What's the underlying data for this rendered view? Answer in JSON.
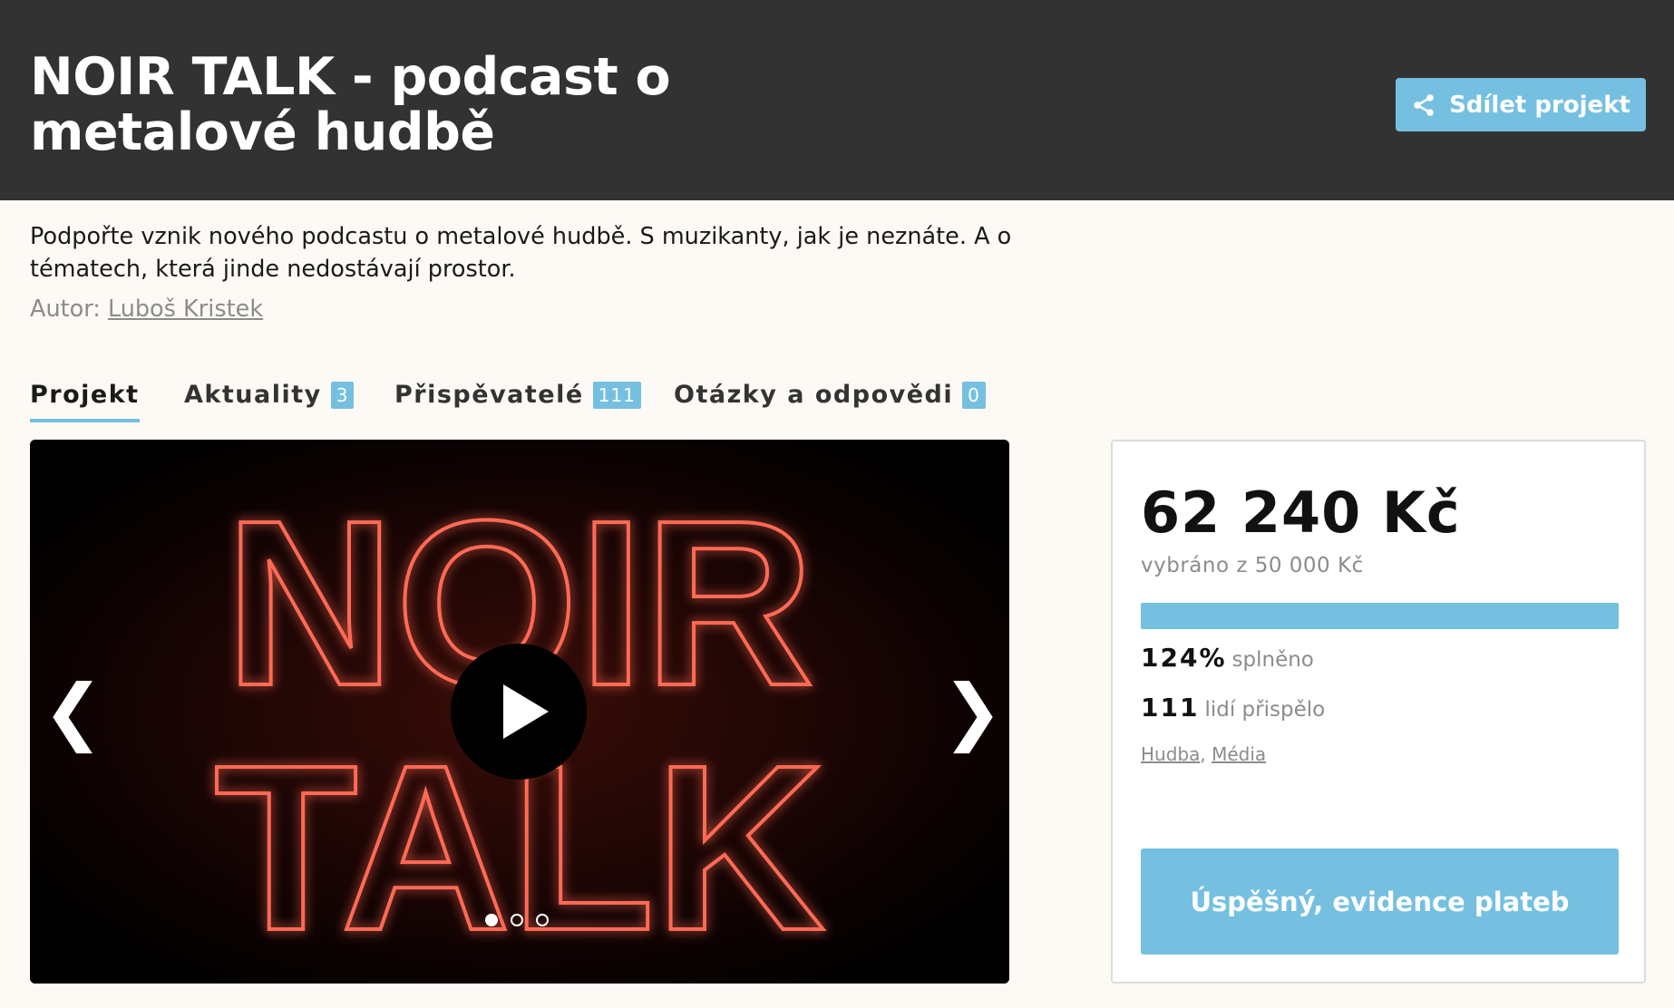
{
  "header": {
    "title": "NOIR TALK - podcast o metalové hudbě",
    "share_label": "Sdílet projekt",
    "share_icon": "share-icon",
    "background_color": "#323232",
    "accent_color": "#75c0e0"
  },
  "intro": {
    "description": "Podpořte vznik nového podcastu o metalové hudbě. S muzikanty, jak je neznáte. A o tématech, která jinde nedostávají prostor.",
    "author_prefix": "Autor:",
    "author_name": "Luboš Kristek"
  },
  "tabs": [
    {
      "label": "Projekt",
      "count": null,
      "active": true
    },
    {
      "label": "Aktuality",
      "count": "3",
      "active": false
    },
    {
      "label": "Přispěvatelé",
      "count": "111",
      "active": false
    },
    {
      "label": "Otázky a odpovědi",
      "count": "0",
      "active": false
    }
  ],
  "media": {
    "logo_text_line1": "NOIR",
    "logo_text_line2": "TALK",
    "prev_arrow": "❮",
    "next_arrow": "❯",
    "play_icon": "play-icon",
    "slides_count": 3,
    "active_slide": 1
  },
  "panel": {
    "amount": "62 240 Kč",
    "collected_text": "vybráno z 50 000 Kč",
    "progress_fraction": 1.0,
    "percent": "124%",
    "percent_label": "splněno",
    "backers": "111",
    "backers_label": "lidí přispělo",
    "categories": [
      "Hudba",
      "Média"
    ],
    "category_separator": ",",
    "status_label": "Úspěšný, evidence plateb"
  }
}
